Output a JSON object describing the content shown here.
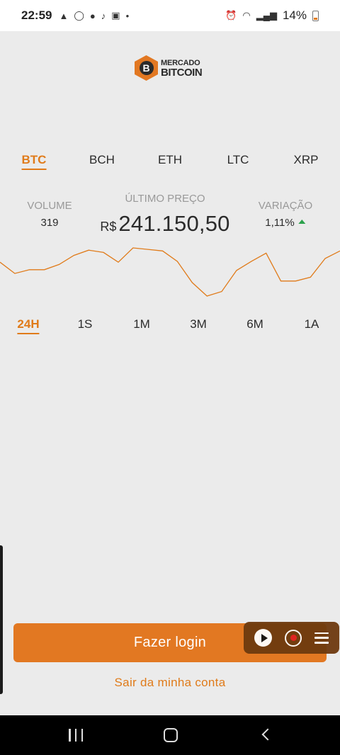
{
  "status_bar": {
    "time": "22:59",
    "battery": "14%",
    "left_icons": [
      "warning-icon",
      "whatsapp-icon",
      "facebook-icon",
      "tiktok-icon",
      "cast-icon",
      "dot-icon"
    ],
    "right_icons": [
      "alarm-icon",
      "wifi-icon",
      "signal-icon",
      "battery-icon"
    ]
  },
  "logo": {
    "line1": "MERCADO",
    "line2": "BITCOIN",
    "mark": "B"
  },
  "coin_tabs": {
    "items": [
      {
        "label": "BTC",
        "active": true
      },
      {
        "label": "BCH",
        "active": false
      },
      {
        "label": "ETH",
        "active": false
      },
      {
        "label": "LTC",
        "active": false
      },
      {
        "label": "XRP",
        "active": false
      }
    ]
  },
  "stats": {
    "volume_label": "VOLUME",
    "volume_value": "319",
    "price_label": "ÚLTIMO PREÇO",
    "price_currency": "R$",
    "price_value": "241.150,50",
    "variation_label": "VARIAÇÃO",
    "variation_value": "1,11%",
    "variation_direction": "up"
  },
  "chart_data": {
    "type": "line",
    "title": "",
    "xlabel": "",
    "ylabel": "",
    "grid": false,
    "color": "#e07b1a",
    "x": [
      0,
      1,
      2,
      3,
      4,
      5,
      6,
      7,
      8,
      9,
      10,
      11,
      12,
      13,
      14,
      15,
      16,
      17,
      18,
      19,
      20,
      21,
      22,
      23
    ],
    "values": [
      55,
      40,
      45,
      45,
      52,
      64,
      71,
      68,
      55,
      74,
      72,
      70,
      56,
      28,
      10,
      16,
      44,
      56,
      67,
      30,
      30,
      35,
      60,
      70
    ]
  },
  "period_tabs": {
    "items": [
      {
        "label": "24H",
        "active": true
      },
      {
        "label": "1S",
        "active": false
      },
      {
        "label": "1M",
        "active": false
      },
      {
        "label": "3M",
        "active": false
      },
      {
        "label": "6M",
        "active": false
      },
      {
        "label": "1A",
        "active": false
      }
    ]
  },
  "actions": {
    "login_label": "Fazer login",
    "logout_label": "Sair da minha conta"
  },
  "colors": {
    "accent": "#e07b1a",
    "background": "#ebebeb",
    "positive": "#2ba24c"
  }
}
